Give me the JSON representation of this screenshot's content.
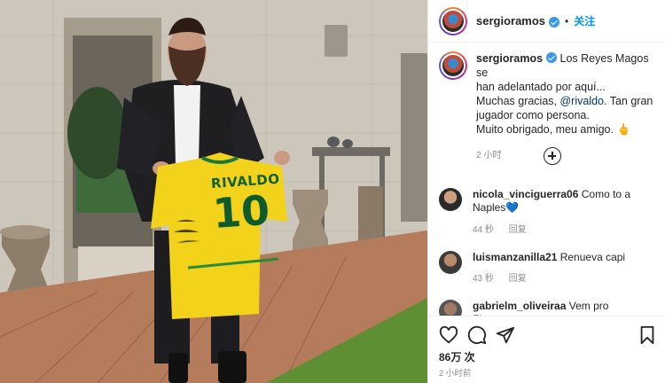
{
  "post": {
    "username": "sergioramos",
    "follow_label": "关注",
    "dot": "•",
    "caption_lines": [
      "Los Reyes Magos se",
      "han adelantado por aquí...",
      "Muchas gracias, ",
      "@rivaldo",
      ". Tan gran",
      "jugador como persona.",
      "Muito obrigado, meu amigo."
    ],
    "caption_emoji": "🖕",
    "caption_time": "2 小时",
    "likes": "86万 次",
    "post_time": "2 小时前"
  },
  "jersey": {
    "name": "RIVALDO",
    "number": "10"
  },
  "comments": [
    {
      "username": "nicola_vinciguerra06",
      "text": "Como to a",
      "text2": "Naples",
      "heart": "💙",
      "age": "44 秒",
      "reply": "回复"
    },
    {
      "username": "luismanzanilla21",
      "text": "Renueva capi",
      "age": "43 秒",
      "reply": "回复"
    },
    {
      "username": "gabrielm_oliveiraa",
      "text": "Vem pro Flamengo"
    }
  ],
  "icons": [
    "verified-badge-icon",
    "add-comment-icon",
    "heart-icon",
    "comment-icon",
    "share-icon",
    "bookmark-icon"
  ],
  "colors": {
    "link": "#0095f6",
    "mention": "#00376b",
    "jersey_yellow": "#f2d21b",
    "jersey_green": "#0f5a2b"
  }
}
